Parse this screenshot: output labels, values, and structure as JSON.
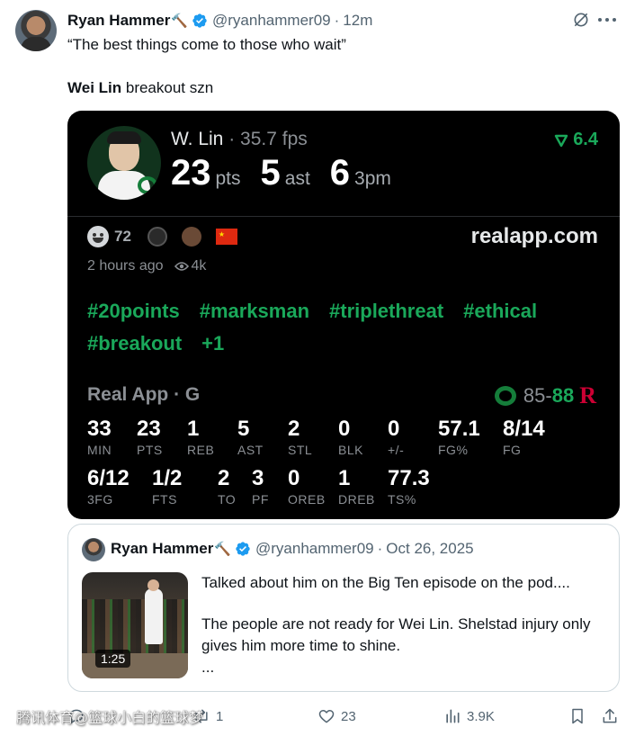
{
  "tweet": {
    "author_name": "Ryan Hammer",
    "author_emoji": "🔨",
    "handle": "@ryanhammer09",
    "dot": "·",
    "time": "12m",
    "text_line1": "“The best things come to those who wait”",
    "text_bold": "Wei Lin",
    "text_rest": " breakout szn"
  },
  "card": {
    "player_name": "W. Lin",
    "fps": " · 35.7 fps",
    "stats": [
      {
        "value": "23",
        "unit": "pts"
      },
      {
        "value": "5",
        "unit": "ast"
      },
      {
        "value": "6",
        "unit": "3pm"
      }
    ],
    "rating": "6.4",
    "reaction_count": "72",
    "site": "realapp.com",
    "time_ago": "2 hours ago",
    "views": "4k",
    "hashtags": [
      "#20points",
      "#marksman",
      "#triplethreat",
      "#ethical",
      "#breakout",
      "+1"
    ],
    "game_title": "Real App · G",
    "score_home": "85",
    "score_sep": "-",
    "score_away": "88",
    "away_logo": "R",
    "box_row1": [
      {
        "v": "33",
        "k": "MIN"
      },
      {
        "v": "23",
        "k": "PTS"
      },
      {
        "v": "1",
        "k": "REB"
      },
      {
        "v": "5",
        "k": "AST"
      },
      {
        "v": "2",
        "k": "STL"
      },
      {
        "v": "0",
        "k": "BLK"
      },
      {
        "v": "0",
        "k": "+/-"
      },
      {
        "v": "57.1",
        "k": "FG%"
      },
      {
        "v": "8/14",
        "k": "FG"
      }
    ],
    "box_row2": [
      {
        "v": "6/12",
        "k": "3FG"
      },
      {
        "v": "1/2",
        "k": "FTS"
      },
      {
        "v": "2",
        "k": "TO"
      },
      {
        "v": "3",
        "k": "PF"
      },
      {
        "v": "0",
        "k": "OREB"
      },
      {
        "v": "1",
        "k": "DREB"
      },
      {
        "v": "77.3",
        "k": "TS%"
      }
    ],
    "colors": {
      "green": "#1aa85a",
      "oregon": "#157d3a",
      "rutgers": "#cc0033"
    }
  },
  "quote": {
    "author_name": "Ryan Hammer",
    "author_emoji": "🔨",
    "handle": "@ryanhammer09",
    "dot": "·",
    "date": "Oct 26, 2025",
    "video_duration": "1:25",
    "text_p1": "Talked about him on the Big Ten episode on the pod....",
    "text_p2": "The people are not ready for Wei Lin. Shelstad injury only gives him more time to shine.",
    "text_p3": "..."
  },
  "actions": {
    "reply_count": "",
    "retweet_count": "1",
    "like_count": "23",
    "view_count": "3.9K"
  },
  "watermark": "腾讯体育@篮球小白的篮球梦"
}
